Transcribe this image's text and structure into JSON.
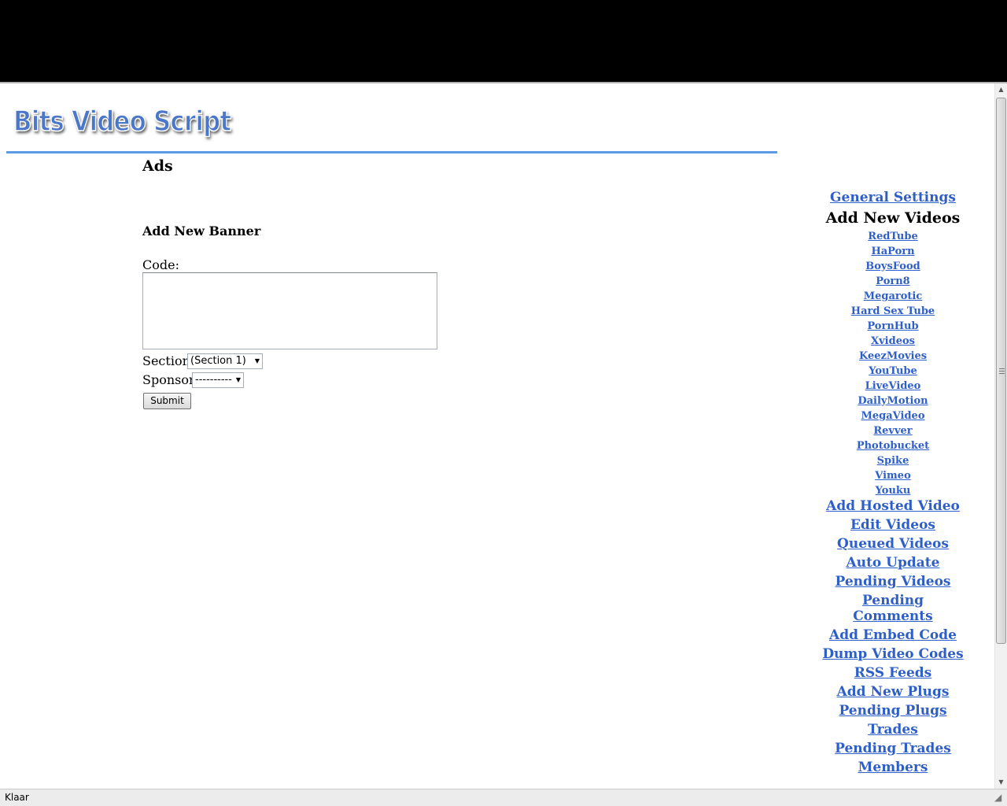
{
  "site": {
    "logo_text": "Bits Video Script"
  },
  "main": {
    "page_title": "Ads",
    "section_title": "Add New Banner",
    "code_label": "Code:",
    "code_value": "",
    "section_label": "Section:",
    "section_selected": "(Section 1)",
    "sponsor_label": "Sponsor:",
    "sponsor_selected": "----------",
    "submit_label": "Submit"
  },
  "nav": {
    "general_settings": "General Settings",
    "add_new_videos_heading": "Add New Videos",
    "sources": [
      "RedTube",
      "HaPorn",
      "BoysFood",
      "Porn8",
      "Megarotic",
      "Hard Sex Tube",
      "PornHub",
      "Xvideos",
      "KeezMovies",
      "YouTube",
      "LiveVideo",
      "DailyMotion",
      "MegaVideo",
      "Revver",
      "Photobucket",
      "Spike",
      "Vimeo",
      "Youku"
    ],
    "items": [
      "Add Hosted Video",
      "Edit Videos",
      "Queued Videos",
      "Auto Update",
      "Pending Videos",
      "Pending Comments",
      "Add Embed Code",
      "Dump Video Codes",
      "RSS Feeds",
      "Add New Plugs",
      "Pending Plugs",
      "Trades",
      "Pending Trades",
      "Members"
    ]
  },
  "statusbar": {
    "text": "Klaar"
  }
}
